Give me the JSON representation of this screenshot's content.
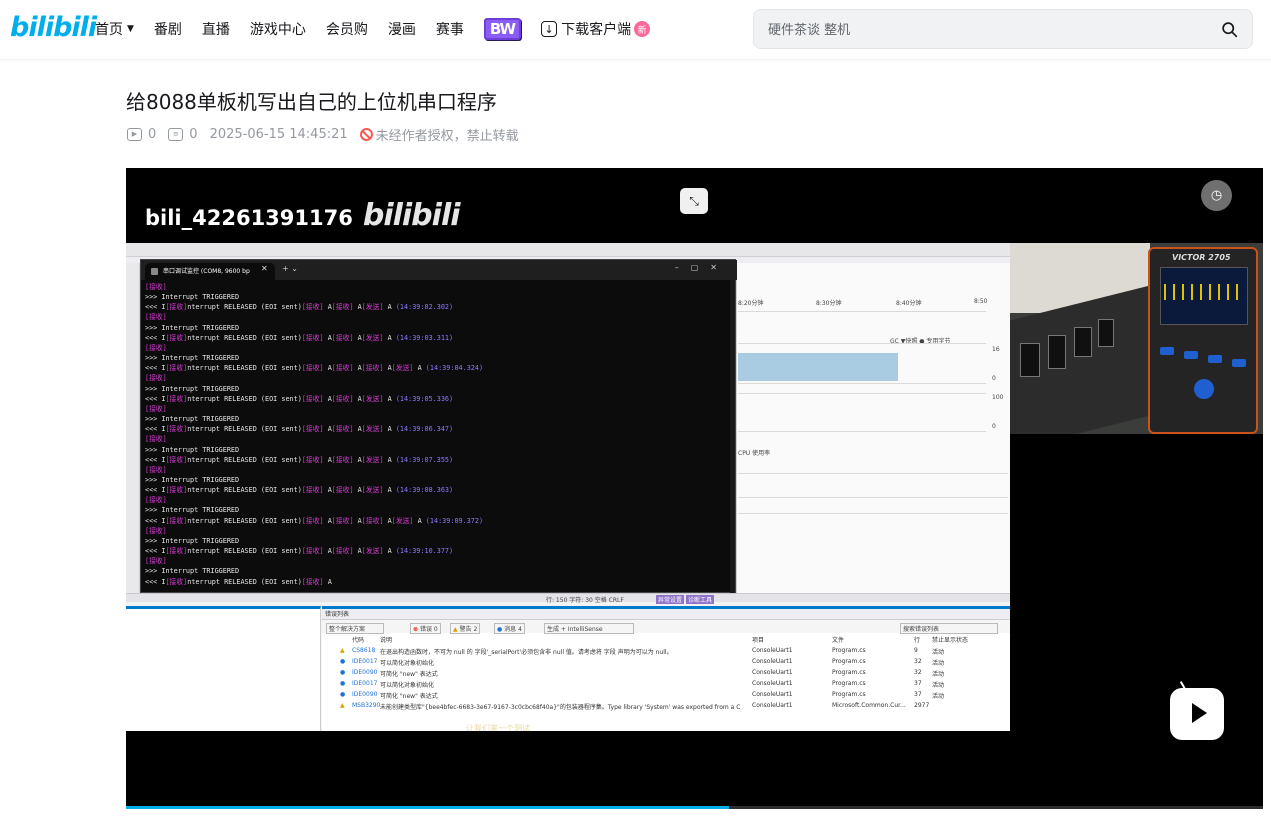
{
  "header": {
    "logo_text": "bilibili",
    "nav": [
      {
        "label": "首页",
        "has_dropdown": true
      },
      {
        "label": "番剧"
      },
      {
        "label": "直播"
      },
      {
        "label": "游戏中心"
      },
      {
        "label": "会员购"
      },
      {
        "label": "漫画"
      },
      {
        "label": "赛事"
      }
    ],
    "special_badge": "BW",
    "download_label": "下载客户端",
    "new_badge": "新",
    "search_placeholder": "硬件茶谈 整机"
  },
  "video": {
    "title": "给8088单板机写出自己的上位机串口程序",
    "play_count": "0",
    "danmaku_count": "0",
    "publish_time": "2025-06-15 14:45:21",
    "copyright_notice": "未经作者授权，禁止转载",
    "progress_fraction": 0.53
  },
  "player": {
    "watermark_user": "bili_42261391176",
    "watermark_logo": "bilibili"
  },
  "terminal": {
    "tab_title": "串口调试监控 (COM8, 9600 bp",
    "lines": [
      [
        {
          "t": "[接收]",
          "c": "tag"
        }
      ],
      [
        {
          "t": ">>> Interrupt TRIGGERED"
        }
      ],
      [
        {
          "t": "<<< I"
        },
        {
          "t": "[接收]",
          "c": "tag"
        },
        {
          "t": "nterrupt RELEASED (EOI sent)"
        },
        {
          "t": "[接收]",
          "c": "tag"
        },
        {
          "t": " A"
        },
        {
          "t": "[接收]",
          "c": "tag"
        },
        {
          "t": " A"
        },
        {
          "t": "[发送]",
          "c": "tag"
        },
        {
          "t": " A "
        },
        {
          "t": "(14:39:02.302)",
          "c": "ts"
        }
      ],
      [
        {
          "t": "[接收]",
          "c": "tag"
        }
      ],
      [
        {
          "t": ">>> Interrupt TRIGGERED"
        }
      ],
      [
        {
          "t": "<<< I"
        },
        {
          "t": "[接收]",
          "c": "tag"
        },
        {
          "t": "nterrupt RELEASED (EOI sent)"
        },
        {
          "t": "[接收]",
          "c": "tag"
        },
        {
          "t": " A"
        },
        {
          "t": "[接收]",
          "c": "tag"
        },
        {
          "t": " A"
        },
        {
          "t": "[发送]",
          "c": "tag"
        },
        {
          "t": " A "
        },
        {
          "t": "(14:39:03.311)",
          "c": "ts"
        }
      ],
      [
        {
          "t": "[接收]",
          "c": "tag"
        }
      ],
      [
        {
          "t": ">>> Interrupt TRIGGERED"
        }
      ],
      [
        {
          "t": "<<< I"
        },
        {
          "t": "[接收]",
          "c": "tag"
        },
        {
          "t": "nterrupt RELEASED (EOI sent)"
        },
        {
          "t": "[接收]",
          "c": "tag"
        },
        {
          "t": " A"
        },
        {
          "t": "[接收]",
          "c": "tag"
        },
        {
          "t": " A"
        },
        {
          "t": "[接收]",
          "c": "tag"
        },
        {
          "t": " A"
        },
        {
          "t": "[发送]",
          "c": "tag"
        },
        {
          "t": " A "
        },
        {
          "t": "(14:39:04.324)",
          "c": "ts"
        }
      ],
      [
        {
          "t": "[接收]",
          "c": "tag"
        }
      ],
      [
        {
          "t": ">>> Interrupt TRIGGERED"
        }
      ],
      [
        {
          "t": "<<< I"
        },
        {
          "t": "[接收]",
          "c": "tag"
        },
        {
          "t": "nterrupt RELEASED (EOI sent)"
        },
        {
          "t": "[接收]",
          "c": "tag"
        },
        {
          "t": " A"
        },
        {
          "t": "[接收]",
          "c": "tag"
        },
        {
          "t": " A"
        },
        {
          "t": "[发送]",
          "c": "tag"
        },
        {
          "t": " A "
        },
        {
          "t": "(14:39:05.336)",
          "c": "ts"
        }
      ],
      [
        {
          "t": "[接收]",
          "c": "tag"
        }
      ],
      [
        {
          "t": ">>> Interrupt TRIGGERED"
        }
      ],
      [
        {
          "t": "<<< I"
        },
        {
          "t": "[接收]",
          "c": "tag"
        },
        {
          "t": "nterrupt RELEASED (EOI sent)"
        },
        {
          "t": "[接收]",
          "c": "tag"
        },
        {
          "t": " A"
        },
        {
          "t": "[接收]",
          "c": "tag"
        },
        {
          "t": " A"
        },
        {
          "t": "[发送]",
          "c": "tag"
        },
        {
          "t": " A "
        },
        {
          "t": "(14:39:06.347)",
          "c": "ts"
        }
      ],
      [
        {
          "t": "[接收]",
          "c": "tag"
        }
      ],
      [
        {
          "t": ">>> Interrupt TRIGGERED"
        }
      ],
      [
        {
          "t": "<<< I"
        },
        {
          "t": "[接收]",
          "c": "tag"
        },
        {
          "t": "nterrupt RELEASED (EOI sent)"
        },
        {
          "t": "[接收]",
          "c": "tag"
        },
        {
          "t": " A"
        },
        {
          "t": "[接收]",
          "c": "tag"
        },
        {
          "t": " A"
        },
        {
          "t": "[发送]",
          "c": "tag"
        },
        {
          "t": " A "
        },
        {
          "t": "(14:39:07.355)",
          "c": "ts"
        }
      ],
      [
        {
          "t": "[接收]",
          "c": "tag"
        }
      ],
      [
        {
          "t": ">>> Interrupt TRIGGERED"
        }
      ],
      [
        {
          "t": "<<< I"
        },
        {
          "t": "[接收]",
          "c": "tag"
        },
        {
          "t": "nterrupt RELEASED (EOI sent)"
        },
        {
          "t": "[接收]",
          "c": "tag"
        },
        {
          "t": " A"
        },
        {
          "t": "[接收]",
          "c": "tag"
        },
        {
          "t": " A"
        },
        {
          "t": "[发送]",
          "c": "tag"
        },
        {
          "t": " A "
        },
        {
          "t": "(14:39:08.363)",
          "c": "ts"
        }
      ],
      [
        {
          "t": "[接收]",
          "c": "tag"
        }
      ],
      [
        {
          "t": ">>> Interrupt TRIGGERED"
        }
      ],
      [
        {
          "t": "<<< I"
        },
        {
          "t": "[接收]",
          "c": "tag"
        },
        {
          "t": "nterrupt RELEASED (EOI sent)"
        },
        {
          "t": "[接收]",
          "c": "tag"
        },
        {
          "t": " A"
        },
        {
          "t": "[接收]",
          "c": "tag"
        },
        {
          "t": " A"
        },
        {
          "t": "[接收]",
          "c": "tag"
        },
        {
          "t": " A"
        },
        {
          "t": "[发送]",
          "c": "tag"
        },
        {
          "t": " A "
        },
        {
          "t": "(14:39:09.372)",
          "c": "ts"
        }
      ],
      [
        {
          "t": "[接收]",
          "c": "tag"
        }
      ],
      [
        {
          "t": ">>> Interrupt TRIGGERED"
        }
      ],
      [
        {
          "t": "<<< I"
        },
        {
          "t": "[接收]",
          "c": "tag"
        },
        {
          "t": "nterrupt RELEASED (EOI sent)"
        },
        {
          "t": "[接收]",
          "c": "tag"
        },
        {
          "t": " A"
        },
        {
          "t": "[接收]",
          "c": "tag"
        },
        {
          "t": " A"
        },
        {
          "t": "[发送]",
          "c": "tag"
        },
        {
          "t": " A "
        },
        {
          "t": "(14:39:10.377)",
          "c": "ts"
        }
      ],
      [
        {
          "t": "[接收]",
          "c": "tag"
        }
      ],
      [
        {
          "t": ">>> Interrupt TRIGGERED"
        }
      ],
      [
        {
          "t": "<<< I"
        },
        {
          "t": "[接收]",
          "c": "tag"
        },
        {
          "t": "nterrupt RELEASED (EOI sent)"
        },
        {
          "t": "[接收]",
          "c": "tag"
        },
        {
          "t": " A"
        }
      ]
    ]
  },
  "ide": {
    "error_list_title": "错误列表",
    "solution_scope": "整个解决方案",
    "errors_label": "错误 0",
    "warnings_label": "警告 2",
    "messages_label": "消息 4",
    "build_filter": "生成 + IntelliSense",
    "search_label": "搜索错误列表",
    "columns": [
      "代码",
      "说明",
      "项目",
      "文件",
      "行",
      "禁止显示状态"
    ],
    "rows": [
      {
        "code": "CS8618",
        "desc": "在退出构造函数时，不可为 null 的 字段'_serialPort'必须包含非 null 值。请考虑将 字段 声明为可以为 null。",
        "project": "ConsoleUart1",
        "file": "Program.cs",
        "line": "9",
        "state": "活动"
      },
      {
        "code": "IDE0017",
        "desc": "可以简化对象初始化",
        "project": "ConsoleUart1",
        "file": "Program.cs",
        "line": "32",
        "state": "活动"
      },
      {
        "code": "IDE0090",
        "desc": "可简化 \"new\" 表达式",
        "project": "ConsoleUart1",
        "file": "Program.cs",
        "line": "32",
        "state": "活动"
      },
      {
        "code": "IDE0017",
        "desc": "可以简化对象初始化",
        "project": "ConsoleUart1",
        "file": "Program.cs",
        "line": "37",
        "state": "活动"
      },
      {
        "code": "IDE0090",
        "desc": "可简化 \"new\" 表达式",
        "project": "ConsoleUart1",
        "file": "Program.cs",
        "line": "37",
        "state": "活动"
      },
      {
        "code": "MSB3290",
        "desc": "未能创建类型库\"{bee4bfec-6683-3e67-9167-3c0cbc68f40a}\"的包装器程序集。Type library 'System' was exported from a CLR assembly and cannot be re-imported as a CLR assembly.",
        "project": "ConsoleUart1",
        "file": "Microsoft.Common.Cur...",
        "line": "2977",
        "state": ""
      }
    ],
    "diag_times": [
      "8:20分钟",
      "8:30分钟",
      "8:40分钟",
      "8:50"
    ],
    "diag_legend": "GC  ▼快照  ● 专用字节",
    "diag_values": [
      "16",
      "0",
      "100",
      "0"
    ],
    "diag_cpu": "CPU 使用率",
    "statusbar": "行: 150   字符: 30   空格   CRLF",
    "status_tabs": [
      "异常设置",
      "诊断工具"
    ],
    "subtitle": "让我们来一个测试"
  },
  "oscilloscope_brand": "VICTOR 2705"
}
